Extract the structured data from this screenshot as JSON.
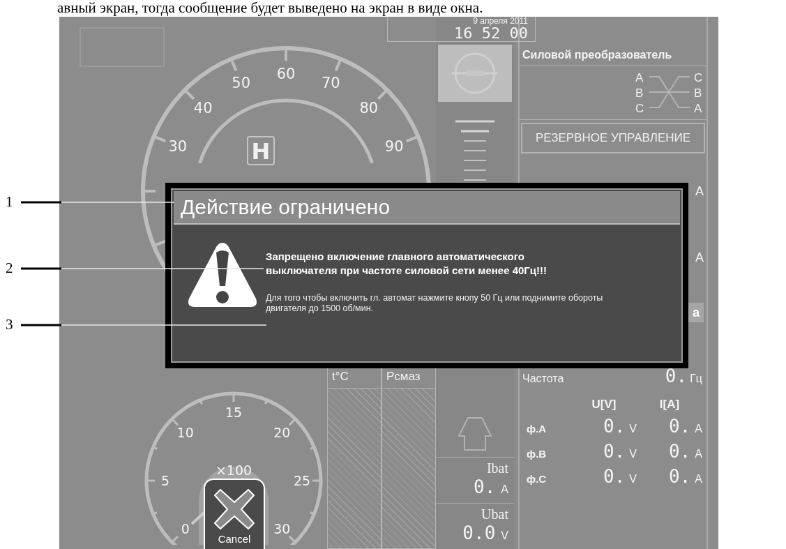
{
  "caption": "авный экран, тогда сообщение будет выведено на экран в виде окна.",
  "clock": {
    "date": "9 апреля 2011",
    "time": "16 52 00"
  },
  "speed_gauge": {
    "labels": [
      "30",
      "40",
      "50",
      "60",
      "70",
      "80",
      "90"
    ],
    "mode": "H"
  },
  "rpm_gauge": {
    "labels": [
      "0",
      "5",
      "10",
      "15",
      "20",
      "25",
      "30"
    ],
    "unit": "×100"
  },
  "bar_headers": [
    "t°C",
    "Рсмаз"
  ],
  "battery": [
    {
      "label": "Ibat",
      "value": "0.",
      "unit": "A"
    },
    {
      "label": "Ubat",
      "value": "0.0",
      "unit": "V"
    }
  ],
  "converter": {
    "title": "Силовой преобразователь",
    "inputs": [
      "A",
      "B",
      "C"
    ],
    "outputs": [
      "C",
      "B",
      "A"
    ]
  },
  "reserve_button": "РЕЗЕРВНОЕ УПРАВЛЕНИЕ",
  "hidden_units": [
    "A",
    "A"
  ],
  "side_button": "a",
  "frequency": {
    "label": "Частота",
    "value": "0.",
    "unit": "Гц"
  },
  "phase_table": {
    "columns": [
      "U[V]",
      "I[A]"
    ],
    "rows": [
      {
        "phase": "ф.A",
        "u": "0.",
        "u_unit": "V",
        "i": "0.",
        "i_unit": "A"
      },
      {
        "phase": "ф.B",
        "u": "0.",
        "u_unit": "V",
        "i": "0.",
        "i_unit": "A"
      },
      {
        "phase": "ф.C",
        "u": "0.",
        "u_unit": "V",
        "i": "0.",
        "i_unit": "A"
      }
    ]
  },
  "dialog": {
    "title": "Действие ограничено",
    "message": "Запрещено включение главного автоматического выключателя при частоте силовой сети менее 40Гц!!!",
    "hint": "Для того чтобы включить гл. автомат нажмите кнопу 50 Гц или поднимите обороты двигателя до 1500 об/мин."
  },
  "cancel_button": "Cancel",
  "callouts": [
    "1",
    "2",
    "3"
  ]
}
